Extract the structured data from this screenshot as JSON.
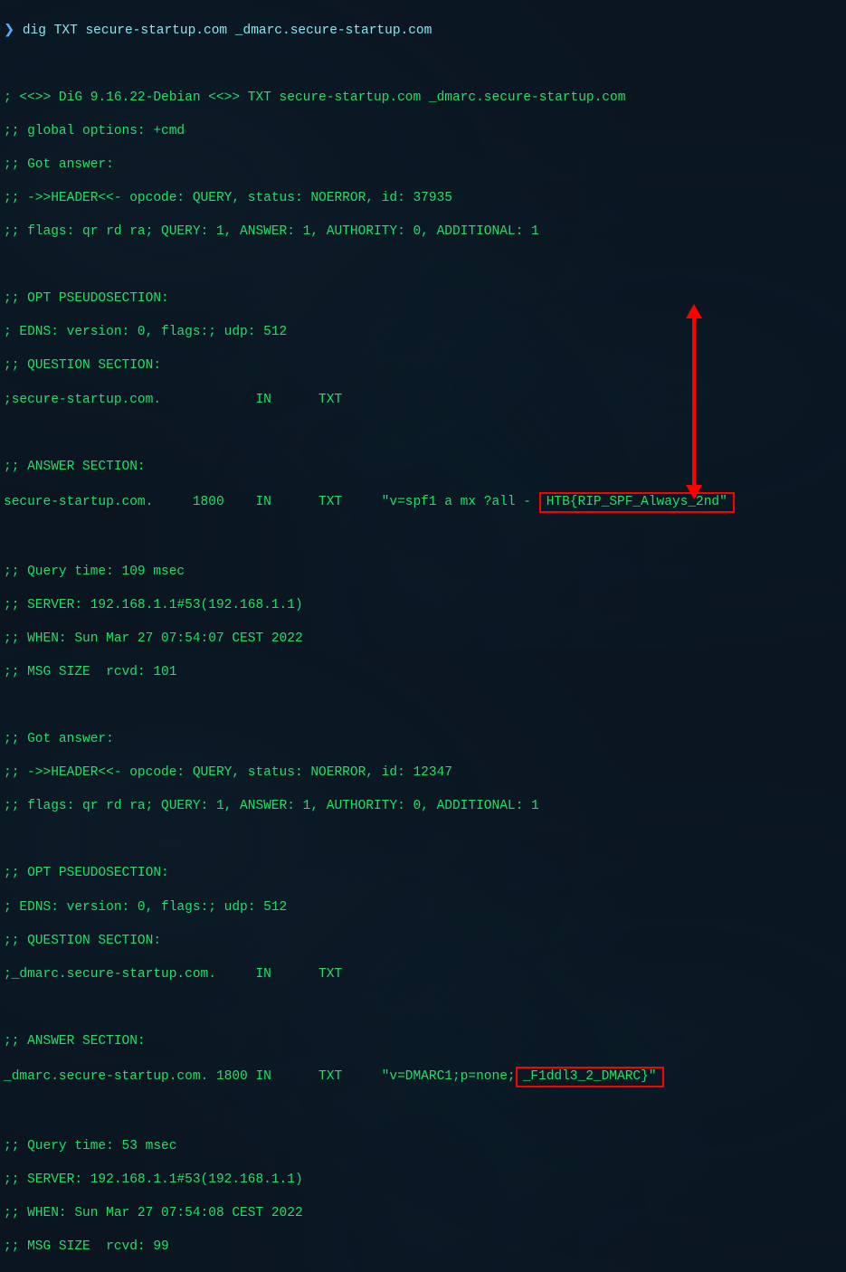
{
  "prompt": {
    "symbol": "❯",
    "command": "dig TXT secure-startup.com _dmarc.secure-startup.com"
  },
  "q1": {
    "header_banner": "; <<>> DiG 9.16.22-Debian <<>> TXT secure-startup.com _dmarc.secure-startup.com",
    "global_opts": ";; global options: +cmd",
    "got_answer": ";; Got answer:",
    "header_line": ";; ->>HEADER<<- opcode: QUERY, status: NOERROR, id: 37935",
    "flags_line": ";; flags: qr rd ra; QUERY: 1, ANSWER: 1, AUTHORITY: 0, ADDITIONAL: 1",
    "opt_title": ";; OPT PSEUDOSECTION:",
    "edns_line": "; EDNS: version: 0, flags:; udp: 512",
    "question_title": ";; QUESTION SECTION:",
    "question_row": ";secure-startup.com.            IN      TXT",
    "answer_title": ";; ANSWER SECTION:",
    "answer_pre": "secure-startup.com.     1800    IN      TXT     \"v=spf1 a mx ?all - ",
    "answer_flag": "HTB{RIP_SPF_Always_2nd\"",
    "query_time": ";; Query time: 109 msec",
    "server": ";; SERVER: 192.168.1.1#53(192.168.1.1)",
    "when": ";; WHEN: Sun Mar 27 07:54:07 CEST 2022",
    "msg_size": ";; MSG SIZE  rcvd: 101"
  },
  "q2": {
    "got_answer": ";; Got answer:",
    "header_line": ";; ->>HEADER<<- opcode: QUERY, status: NOERROR, id: 12347",
    "flags_line": ";; flags: qr rd ra; QUERY: 1, ANSWER: 1, AUTHORITY: 0, ADDITIONAL: 1",
    "opt_title": ";; OPT PSEUDOSECTION:",
    "edns_line": "; EDNS: version: 0, flags:; udp: 512",
    "question_title": ";; QUESTION SECTION:",
    "question_row": ";_dmarc.secure-startup.com.     IN      TXT",
    "answer_title": ";; ANSWER SECTION:",
    "answer_pre": "_dmarc.secure-startup.com. 1800 IN      TXT     \"v=DMARC1;p=none;",
    "answer_flag": "_F1ddl3_2_DMARC}\"",
    "query_time": ";; Query time: 53 msec",
    "server": ";; SERVER: 192.168.1.1#53(192.168.1.1)",
    "when": ";; WHEN: Sun Mar 27 07:54:08 CEST 2022",
    "msg_size": ";; MSG SIZE  rcvd: 99"
  }
}
